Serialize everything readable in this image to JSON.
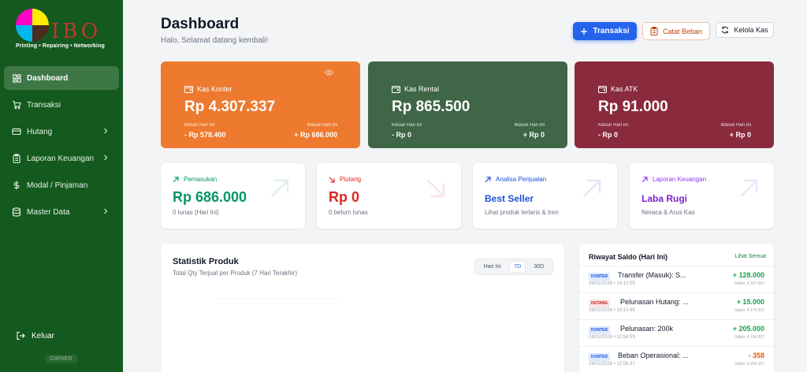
{
  "colors": {
    "sidebar": "#14591e",
    "primary": "#2563eb",
    "konter": "#ed7a2f",
    "rental": "#3e6647",
    "atk": "#8a2a3d",
    "positive": "#059669",
    "negative": "#dc2626"
  },
  "sidebar": {
    "logo_text": "IBO",
    "tagline": "Printing • Repairing • Networking",
    "items": [
      {
        "label": "Dashboard",
        "icon": "dashboard-icon",
        "active": true
      },
      {
        "label": "Transaksi",
        "icon": "cart-icon"
      },
      {
        "label": "Hutang",
        "icon": "card-icon",
        "expandable": true
      },
      {
        "label": "Laporan Keuangan",
        "icon": "clipboard-icon",
        "expandable": true
      },
      {
        "label": "Modal / Pinjaman",
        "icon": "dollar-icon"
      },
      {
        "label": "Master Data",
        "icon": "database-icon",
        "expandable": true
      }
    ],
    "logout_label": "Keluar",
    "role": "OWNER"
  },
  "header": {
    "title": "Dashboard",
    "subtitle": "Halo, Selamat datang kembali!",
    "btn_transaksi": "Transaksi",
    "btn_catat_beban": "Catat Beban",
    "btn_kelola_kas": "Kelola Kas"
  },
  "cash_cards": [
    {
      "name": "Kas Konter",
      "amount": "Rp 4.307.337",
      "out_label": "Keluar Hari Ini",
      "out_value": "- Rp 578.400",
      "in_label": "Masuk Hari Ini",
      "in_value": "+ Rp 686.000"
    },
    {
      "name": "Kas Rental",
      "amount": "Rp 865.500",
      "out_label": "Keluar Hari Ini",
      "out_value": "- Rp 0",
      "in_label": "Masuk Hari Ini",
      "in_value": "+ Rp 0"
    },
    {
      "name": "Kas ATK",
      "amount": "Rp 91.000",
      "out_label": "Keluar Hari Ini",
      "out_value": "- Rp 0",
      "in_label": "Masuk Hari Ini",
      "in_value": "+ Rp 0"
    }
  ],
  "stat_cards": [
    {
      "label": "Pemasukan",
      "value": "Rp 686.000",
      "sub": "0 lunas (Hari Ini)"
    },
    {
      "label": "Piutang",
      "value": "Rp 0",
      "sub": "0 belum lunas"
    },
    {
      "label": "Analisa Penjualan",
      "value": "Best Seller",
      "sub": "Lihat produk terlaris & tren"
    },
    {
      "label": "Laporan Keuangan",
      "value": "Laba Rugi",
      "sub": "Neraca & Arus Kas"
    }
  ],
  "chart": {
    "title": "Statistik Produk",
    "subtitle": "Total Qty Terjual per Produk (7 Hari Terakhir)",
    "ranges": [
      "Hari Ini",
      "7D",
      "30D"
    ],
    "active_range": "7D"
  },
  "history": {
    "title": "Riwayat Saldo (Hari Ini)",
    "link": "Lihat Semua",
    "rows": [
      {
        "badge": "KONTER",
        "desc": "Transfer (Masuk): S...",
        "date": "26/02/2026 • 14:12:55",
        "amount": "+ 128.000",
        "saldo": "Saldo: 4.307.337",
        "type": "in"
      },
      {
        "badge": "HUTANG",
        "desc": "Pelunasan Hutang: ...",
        "date": "26/02/2026 • 14:12:48",
        "amount": "+ 15.000",
        "saldo": "Saldo: 4.179.337",
        "type": "in"
      },
      {
        "badge": "KONTER",
        "desc": "Pelunasan: 200k",
        "date": "26/02/2026 • 12:58:59",
        "amount": "+ 205.000",
        "saldo": "Saldo: 4.164.337",
        "type": "in"
      },
      {
        "badge": "KONTER",
        "desc": "Beban Operasional: ...",
        "date": "26/02/2026 • 12:58:37",
        "amount": "- 358",
        "saldo": "Saldo: 3.959.337",
        "type": "out"
      }
    ]
  }
}
